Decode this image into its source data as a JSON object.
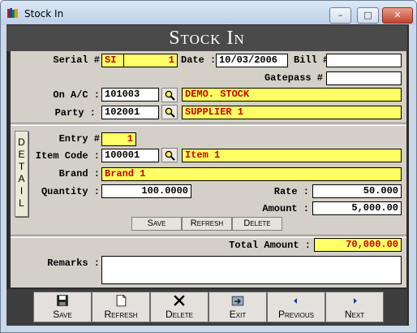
{
  "window": {
    "title": "Stock In"
  },
  "form_title": "Stock In",
  "header": {
    "serial_label": "Serial #",
    "serial_prefix": "SI",
    "serial_number": "1",
    "date_label": "Date :",
    "date_value": "10/03/2006",
    "bill_label": "Bill #",
    "bill_value": "",
    "gatepass_label": "Gatepass #",
    "gatepass_value": "",
    "onac_label": "On A/C :",
    "onac_code": "101003",
    "onac_name": "DEMO. STOCK",
    "party_label": "Party :",
    "party_code": "102001",
    "party_name": "SUPPLIER 1"
  },
  "detail": {
    "tab_letters": [
      "D",
      "E",
      "T",
      "A",
      "I",
      "L"
    ],
    "entry_label": "Entry #",
    "entry_value": "1",
    "item_code_label": "Item Code :",
    "item_code_value": "100001",
    "item_name": "Item 1",
    "brand_label": "Brand :",
    "brand_value": "Brand 1",
    "quantity_label": "Quantity :",
    "quantity_value": "100.0000",
    "rate_label": "Rate :",
    "rate_value": "50.000",
    "amount_label": "Amount :",
    "amount_value": "5,000.00",
    "buttons": {
      "save": "Save",
      "refresh": "Refresh",
      "delete": "Delete"
    }
  },
  "footer": {
    "total_label": "Total Amount :",
    "total_value": "70,000.00",
    "remarks_label": "Remarks :",
    "remarks_value": ""
  },
  "toolbar": {
    "save": "Save",
    "refresh": "Refresh",
    "delete": "Delete",
    "exit": "Exit",
    "previous": "Previous",
    "next": "Next"
  },
  "icons": {
    "app": "books-icon",
    "search": "magnifier-icon",
    "save": "floppy-disk-icon",
    "refresh": "document-icon",
    "delete": "x-icon",
    "exit": "exit-icon",
    "previous": "arrow-left-icon",
    "next": "arrow-right-icon"
  },
  "colors": {
    "highlight_bg": "#ffff66",
    "highlight_text": "#cc0000"
  }
}
